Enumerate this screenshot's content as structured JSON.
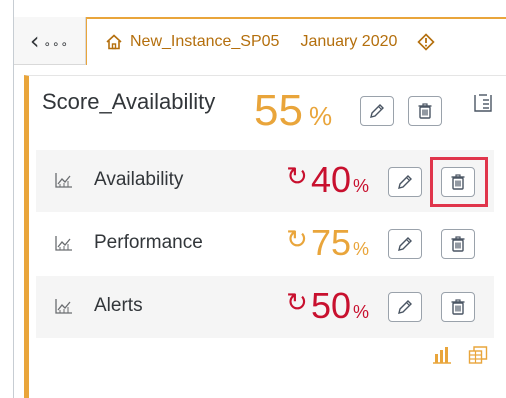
{
  "breadcrumb": {
    "back_dots": "∘∘∘",
    "instance": "New_Instance_SP05",
    "date": "January 2020"
  },
  "card": {
    "title": "Score_Availability",
    "score": "55",
    "score_unit": "%"
  },
  "rows": [
    {
      "label": "Availability",
      "trend": "↻",
      "value": "40",
      "unit": "%",
      "color": "#c8102e"
    },
    {
      "label": "Performance",
      "trend": "↻",
      "value": "75",
      "unit": "%",
      "color": "#e9a53b"
    },
    {
      "label": "Alerts",
      "trend": "↻",
      "value": "50",
      "unit": "%",
      "color": "#c8102e"
    }
  ],
  "colors": {
    "accent": "#e9a53b",
    "critical": "#c8102e",
    "highlight": "#e0354b"
  },
  "icons": [
    "home-icon",
    "warning-icon",
    "edit-icon",
    "delete-icon",
    "collapse-icon",
    "kpi-chart-icon",
    "bar-chart-icon",
    "table-icon"
  ]
}
